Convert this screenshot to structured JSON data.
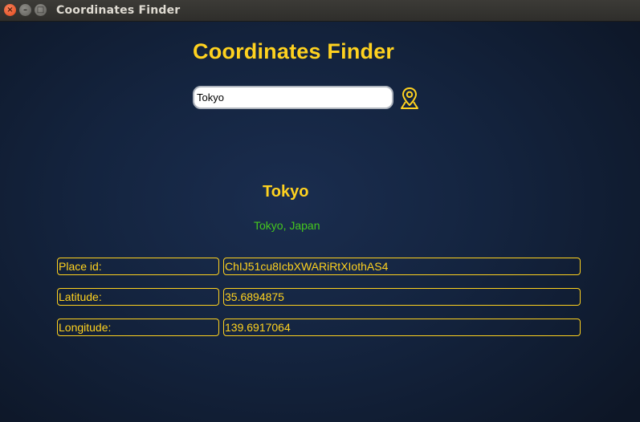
{
  "window": {
    "title": "Coordinates Finder",
    "close_glyph": "×",
    "minimize_glyph": "–",
    "maximize_glyph": "□"
  },
  "app": {
    "title": "Coordinates Finder",
    "accent_color": "#ffd21f",
    "address_color": "#45c81e"
  },
  "search": {
    "value": "Tokyo",
    "button_icon": "map-pin-icon"
  },
  "result": {
    "name": "Tokyo",
    "address": "Tokyo, Japan",
    "fields": [
      {
        "label": "Place id:",
        "value": "ChIJ51cu8IcbXWARiRtXIothAS4"
      },
      {
        "label": "Latitude:",
        "value": "35.6894875"
      },
      {
        "label": "Longitude:",
        "value": "139.6917064"
      }
    ]
  }
}
